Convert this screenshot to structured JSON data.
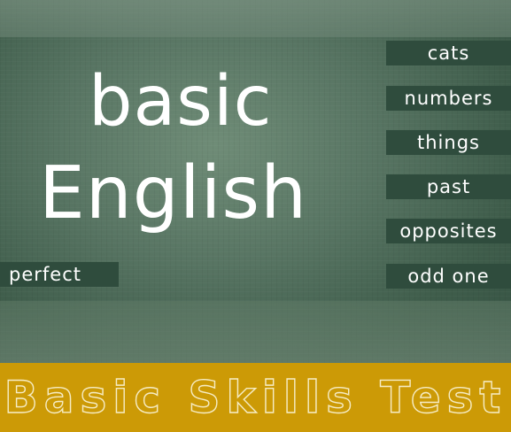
{
  "board": {
    "title_line1": "basic",
    "title_line2": "English"
  },
  "menu": {
    "items": [
      {
        "label": "cats"
      },
      {
        "label": "numbers"
      },
      {
        "label": "things"
      },
      {
        "label": "past"
      },
      {
        "label": "opposites"
      },
      {
        "label": "odd one"
      }
    ],
    "perfect_label": "perfect"
  },
  "footer": {
    "title": "Basic Skills Test"
  },
  "colors": {
    "board_green": "#587563",
    "button_dark_green": "#2f4c3d",
    "footer_gold": "#cc9a06",
    "text_white": "#ffffff"
  }
}
